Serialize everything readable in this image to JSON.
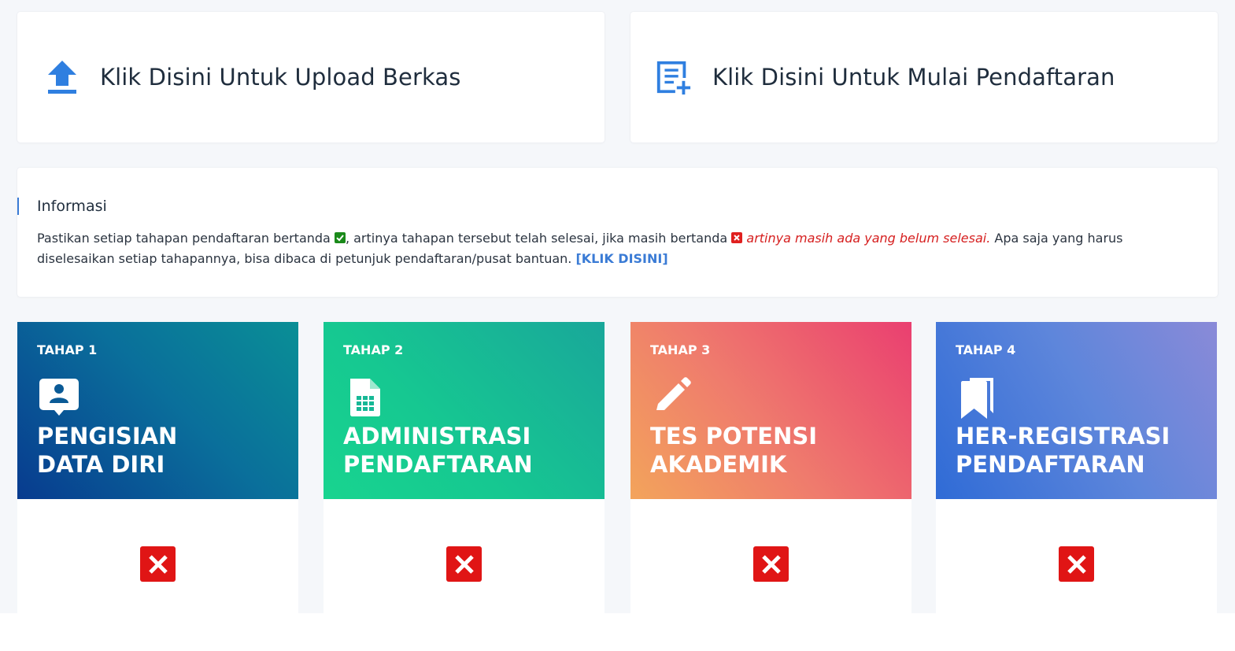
{
  "actions": {
    "upload": {
      "label": "Klik Disini Untuk Upload Berkas",
      "icon": "upload-icon"
    },
    "daftar": {
      "label": "Klik Disini Untuk Mulai Pendaftaran",
      "icon": "note-add-icon"
    }
  },
  "info": {
    "title": "Informasi",
    "text_1": "Pastikan setiap tahapan pendaftaran bertanda ",
    "text_2": ", artinya tahapan tersebut telah selesai, jika masih bertanda ",
    "text_red": "artinya masih ada yang belum selesai.",
    "text_3": " Apa saja yang harus diselesaikan setiap tahapannya, bisa dibaca di petunjuk pendaftaran/pusat bantuan. ",
    "link": "[KLIK DISINI]"
  },
  "stages": [
    {
      "tag": "TAHAP 1",
      "line1": "PENGISIAN",
      "line2": "DATA DIRI",
      "icon": "contact-card-icon",
      "status": "not-complete"
    },
    {
      "tag": "TAHAP 2",
      "line1": "ADMINISTRASI",
      "line2": "PENDAFTARAN",
      "icon": "spreadsheet-file-icon",
      "status": "not-complete"
    },
    {
      "tag": "TAHAP 3",
      "line1": "TES POTENSI",
      "line2": "AKADEMIK",
      "icon": "pencil-icon",
      "status": "not-complete"
    },
    {
      "tag": "TAHAP 4",
      "line1": "HER-REGISTRASI",
      "line2": "PENDAFTARAN",
      "icon": "bookmarks-icon",
      "status": "not-complete"
    }
  ],
  "colors": {
    "accent": "#3a7bd5",
    "success": "#1a8a1a",
    "danger": "#e01515"
  }
}
